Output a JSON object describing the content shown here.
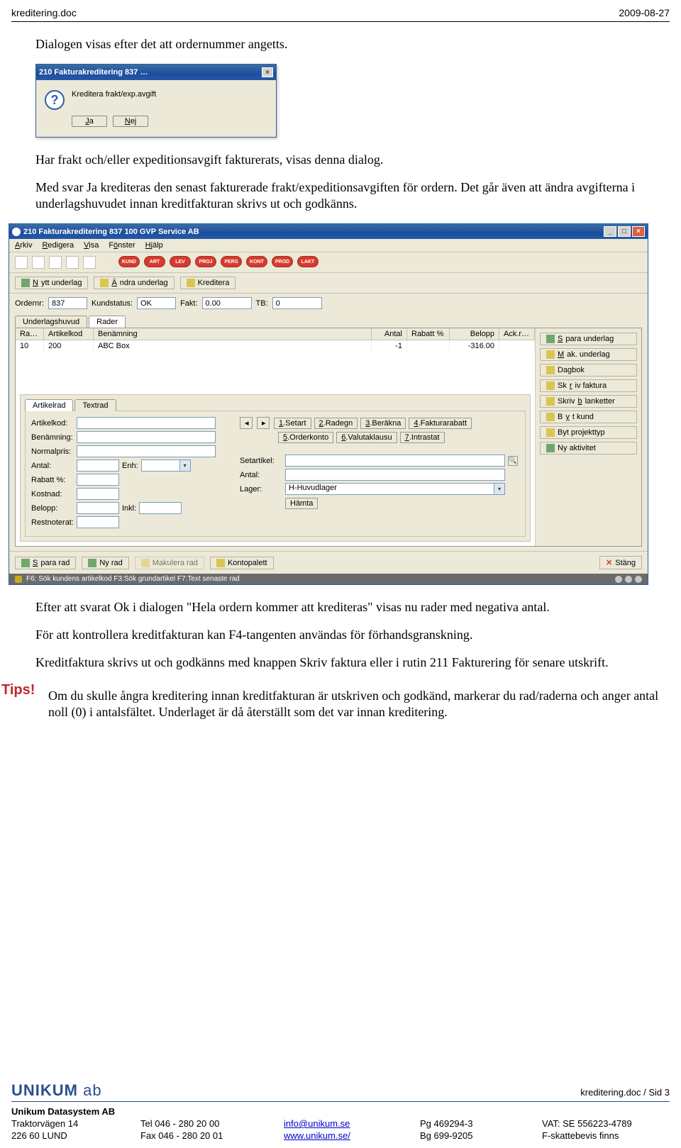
{
  "header": {
    "left": "kreditering.doc",
    "right": "2009-08-27"
  },
  "body": {
    "p1": "Dialogen visas efter det att ordernummer angetts.",
    "p2": "Har frakt och/eller expeditionsavgift fakturerats, visas denna dialog.",
    "p3": "Med svar Ja krediteras den senast fakturerade frakt/expeditionsavgiften för ordern. Det går även att ändra avgifterna i underlagshuvudet innan kreditfakturan skrivs ut och godkänns.",
    "p4": "Efter att svarat Ok i dialogen \"Hela ordern kommer att krediteras\" visas nu rader med negativa antal.",
    "p5": "För att kontrollera kreditfakturan kan F4-tangenten användas för förhandsgranskning.",
    "p6": "Kreditfaktura skrivs ut och godkänns med knappen Skriv faktura eller i rutin 211 Fakturering för senare utskrift.",
    "tips_label": "Tips!",
    "tips_text": "Om du skulle ångra kreditering innan kreditfakturan är utskriven och godkänd, markerar du rad/raderna och anger antal noll (0) i antalsfältet. Underlaget är då återställt som det var innan kreditering."
  },
  "dialog": {
    "title": "210 Fakturakreditering 837 …",
    "message": "Kreditera frakt/exp.avgift",
    "yes": "Ja",
    "no": "Nej"
  },
  "appwin": {
    "title": "210 Fakturakreditering 837 100 GVP Service AB",
    "menus": [
      "Arkiv",
      "Redigera",
      "Visa",
      "Fönster",
      "Hjälp"
    ],
    "pills": [
      "KUND",
      "ART",
      "LEV",
      "PROJ",
      "PERS",
      "KONT",
      "PROD",
      "LAKT"
    ],
    "sub_buttons": {
      "nytt": "Nytt underlag",
      "andra": "Ändra underlag",
      "kred": "Kreditera"
    },
    "fields": {
      "ordernr_label": "Ordernr:",
      "ordernr": "837",
      "kundstatus_label": "Kundstatus:",
      "kundstatus": "OK",
      "fakt_label": "Fakt:",
      "fakt": "0.00",
      "tb_label": "TB:",
      "tb": "0"
    },
    "tabs": {
      "huvud": "Underlagshuvud",
      "rader": "Rader"
    },
    "cols": {
      "ra": "Ra…",
      "art": "Artikelkod",
      "ben": "Benämning",
      "antal": "Antal",
      "rabatt": "Rabatt %",
      "belopp": "Belopp",
      "ack": "Ack.r…"
    },
    "row": {
      "ra": "10",
      "art": "200",
      "ben": "ABC Box",
      "antal": "-1",
      "rabatt": "",
      "belopp": "-316.00",
      "ack": ""
    },
    "right_buttons": [
      "Spara underlag",
      "Mak. underlag",
      "Dagbok",
      "Skriv faktura",
      "Skriv blanketter",
      "Byt kund",
      "Byt projekttyp",
      "Ny aktivitet"
    ],
    "inner_tabs": {
      "artrad": "Artikelrad",
      "textrad": "Textrad"
    },
    "num_buttons": [
      "1.Setart",
      "2.Radegn",
      "3.Beräkna",
      "4.Fakturarabatt",
      "5.Orderkonto",
      "6.Valutaklausu",
      "7.Intrastat"
    ],
    "left_labels": {
      "artikelkod": "Artikelkod:",
      "benamning": "Benämning:",
      "normalpris": "Normalpris:",
      "antal": "Antal:",
      "enh": "Enh:",
      "rabatt": "Rabatt %:",
      "kostnad": "Kostnad:",
      "belopp": "Belopp:",
      "inkl": "Inkl:",
      "restnoterat": "Restnoterat:"
    },
    "right_labels": {
      "setartikel": "Setartikel:",
      "antal": "Antal:",
      "lager": "Lager:",
      "lager_val": "H-Huvudlager",
      "hamta": "Hämta"
    },
    "bottom_buttons": {
      "spara": "Spara rad",
      "ny": "Ny rad",
      "mak": "Makulera rad",
      "konto": "Kontopalett",
      "stang": "Stäng"
    },
    "status": "F6: Sök kundens artikelkod F3:Sök grundartikel F7:Text senaste rad"
  },
  "footer": {
    "logo": "UNIKUM",
    "logo_suffix": "ab",
    "docref": "kreditering.doc / Sid 3",
    "company": "Unikum Datasystem AB",
    "addr1": "Traktorvägen 14",
    "addr2": "226 60  LUND",
    "tel": "Tel  046 - 280 20 00",
    "fax": "Fax  046 - 280 20 01",
    "email": "info@unikum.se",
    "web": "www.unikum.se/",
    "pg": "Pg  469294-3",
    "bg": "Bg  699-9205",
    "vat": "VAT: SE 556223-4789",
    "fskatt": "F-skattebevis finns"
  }
}
